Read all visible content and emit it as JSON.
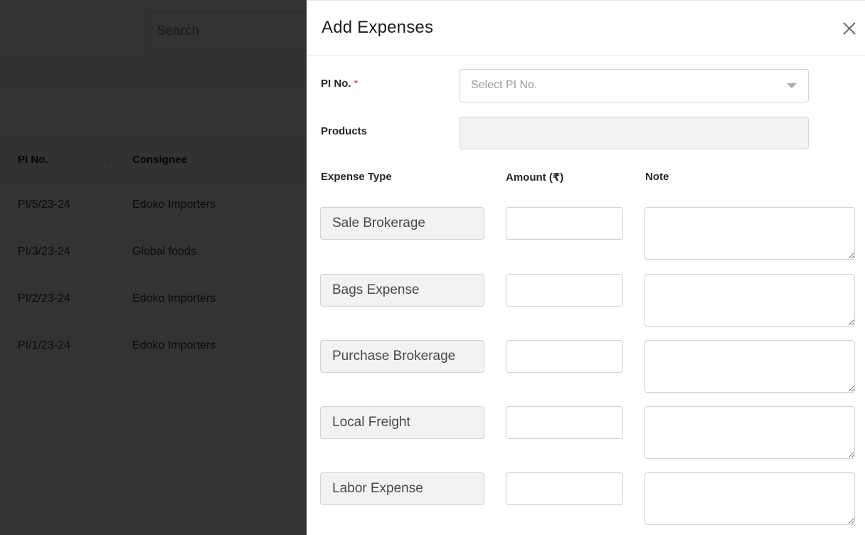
{
  "background": {
    "search": {
      "placeholder": "Search"
    },
    "table": {
      "columns": [
        "PI No.",
        "Consignee"
      ],
      "rows": [
        {
          "pi_no": "PI/5/23-24",
          "consignee": "Edoko Importers"
        },
        {
          "pi_no": "PI/3/23-24",
          "consignee": "Global foods"
        },
        {
          "pi_no": "PI/2/23-24",
          "consignee": "Edoko Importers"
        },
        {
          "pi_no": "PI/1/23-24",
          "consignee": "Edoko Importers"
        }
      ],
      "sort_icon": "sort-arrows-icon"
    }
  },
  "drawer": {
    "title": "Add Expenses",
    "close_icon": "close-icon",
    "pi_no": {
      "label": "PI No.",
      "required_mark": "*",
      "placeholder": "Select PI No.",
      "caret_icon": "caret-down-icon"
    },
    "products": {
      "label": "Products",
      "value": ""
    },
    "columns": {
      "expense_type": "Expense Type",
      "amount": "Amount (₹)",
      "note": "Note"
    },
    "expenses": [
      {
        "type": "Sale Brokerage",
        "amount": "",
        "note": ""
      },
      {
        "type": "Bags Expense",
        "amount": "",
        "note": ""
      },
      {
        "type": "Purchase Brokerage",
        "amount": "",
        "note": ""
      },
      {
        "type": "Local Freight",
        "amount": "",
        "note": ""
      },
      {
        "type": "Labor Expense",
        "amount": "",
        "note": ""
      }
    ]
  },
  "colors": {
    "overlay": "#333333",
    "required": "#e53935",
    "readonly_fill": "#f2f2f2",
    "border": "#cfd3d8"
  }
}
